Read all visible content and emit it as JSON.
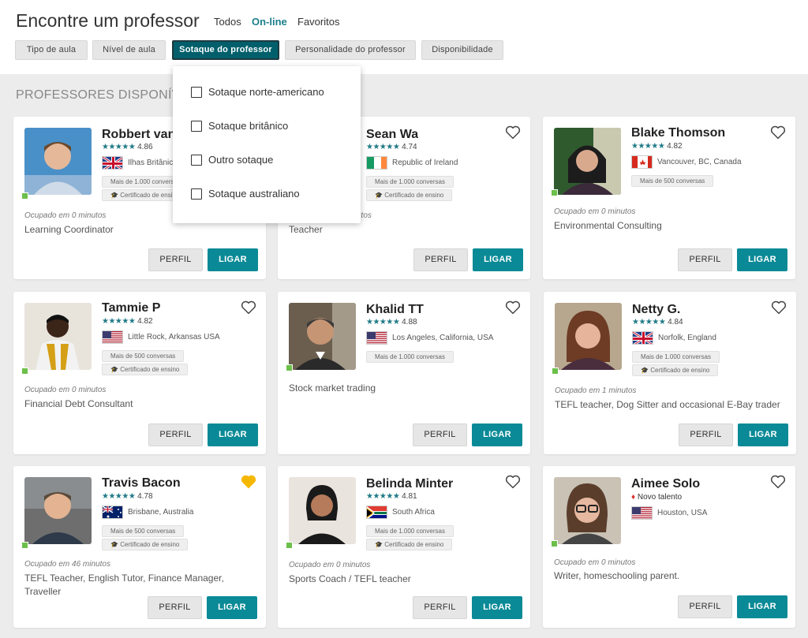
{
  "header": {
    "title": "Encontre um professor",
    "tabs": [
      "Todos",
      "On-line",
      "Favoritos"
    ],
    "active_tab": "On-line",
    "filters": [
      "Tipo de aula",
      "Nível de aula",
      "Sotaque do professor",
      "Personalidade do professor",
      "Disponibilidade"
    ],
    "active_filter": "Sotaque do professor"
  },
  "section_title": "PROFESSORES DISPONÍVE",
  "dropdown": {
    "options": [
      "Sotaque norte-americano",
      "Sotaque britânico",
      "Outro sotaque",
      "Sotaque australiano"
    ]
  },
  "buttons": {
    "perfil": "PERFIL",
    "ligar": "LIGAR"
  },
  "stars_glyph": "★★★★★",
  "teachers": [
    {
      "name": "Robbert van",
      "rating": "4.86",
      "location": "Ilhas Britânic",
      "flag": "uk",
      "badges": [
        "Mais de 1.000 conversas",
        "Certificado de ensino"
      ],
      "busy": "Ocupado em 0 minutos",
      "description": "Learning Coordinator",
      "favorite": false
    },
    {
      "name": "Sean Wa",
      "rating": "4.74",
      "location": "Republic of Ireland",
      "flag": "ie",
      "badges": [
        "Mais de 1.000 conversas",
        "Certificado de ensino"
      ],
      "busy": "utos",
      "description": "Teacher",
      "favorite": false
    },
    {
      "name": "Blake Thomson",
      "rating": "4.82",
      "location": "Vancouver, BC, Canada",
      "flag": "ca",
      "badges": [
        "Mais de 500 conversas"
      ],
      "busy": "Ocupado em 0 minutos",
      "description": "Environmental Consulting",
      "favorite": false
    },
    {
      "name": "Tammie P",
      "rating": "4.82",
      "location": "Little Rock, Arkansas USA",
      "flag": "us",
      "badges": [
        "Mais de 500 conversas",
        "Certificado de ensino"
      ],
      "busy": "Ocupado em 0 minutos",
      "description": "Financial Debt Consultant",
      "favorite": false
    },
    {
      "name": "Khalid TT",
      "rating": "4.88",
      "location": "Los Angeles, California, USA",
      "flag": "us",
      "badges": [
        "Mais de 1.000 conversas"
      ],
      "busy": "",
      "description": "Stock market trading",
      "favorite": false
    },
    {
      "name": "Netty G.",
      "rating": "4.84",
      "location": "Norfolk, England",
      "flag": "uk",
      "badges": [
        "Mais de 1.000 conversas",
        "Certificado de ensino"
      ],
      "busy": "Ocupado em 1 minutos",
      "description": "TEFL teacher, Dog Sitter and occasional E-Bay trader",
      "favorite": false
    },
    {
      "name": "Travis Bacon",
      "rating": "4.78",
      "location": "Brisbane, Australia",
      "flag": "au",
      "badges": [
        "Mais de 500 conversas",
        "Certificado de ensino"
      ],
      "busy": "Ocupado em 46 minutos",
      "description": "TEFL Teacher, English Tutor, Finance Manager, Traveller",
      "favorite": true
    },
    {
      "name": "Belinda Minter",
      "rating": "4.81",
      "location": "South Africa",
      "flag": "za",
      "badges": [
        "Mais de 1.000 conversas",
        "Certificado de ensino"
      ],
      "busy": "Ocupado em 0 minutos",
      "description": "Sports Coach / TEFL teacher",
      "favorite": false
    },
    {
      "name": "Aimee Solo",
      "novo": "Novo talento",
      "location": "Houston, USA",
      "flag": "us",
      "badges": [],
      "busy": "Ocupado em 0 minutos",
      "description": "Writer, homeschooling parent.",
      "favorite": false
    }
  ],
  "colors": {
    "accent": "#0a8a96",
    "active_filter": "#005f6b",
    "online": "#6cc04a",
    "favorite": "#f5b800"
  }
}
